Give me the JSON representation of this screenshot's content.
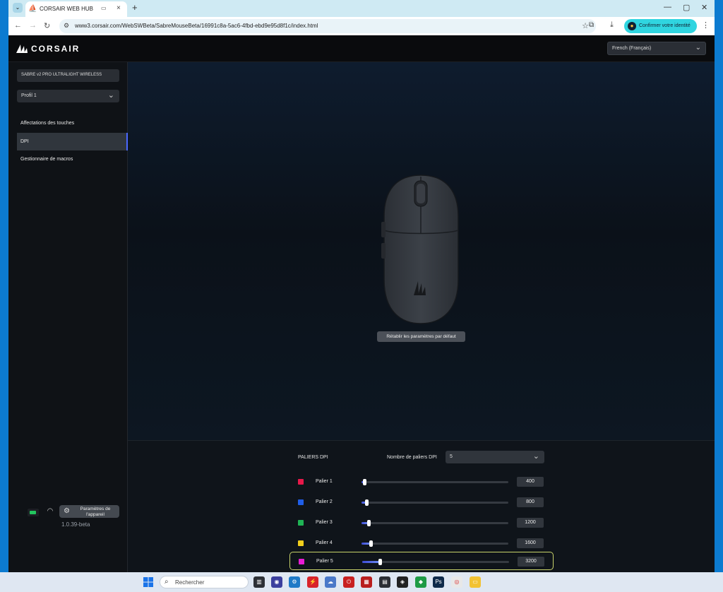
{
  "browser": {
    "tab_title": "CORSAIR WEB HUB",
    "url": "www3.corsair.com/WebSWBeta/SabreMouseBeta/16991c8a-5ac6-4fbd-ebd9e95d8f1c/index.html",
    "confirm_identity": "Confirmer votre identité"
  },
  "app": {
    "logo_text": "CORSAIR",
    "language": "French (Français)",
    "device_name": "SABRE v2 PRO ULTRALIGHT WIRELESS",
    "profile": "Profil 1",
    "nav": [
      {
        "label": "Affectations des touches"
      },
      {
        "label": "DPI"
      },
      {
        "label": "Gestionnaire de macros"
      }
    ],
    "device_settings": "Paramètres de l'appareil",
    "version": "1.0.39-beta",
    "reset_button": "Rétablir les paramètres par défaut"
  },
  "dpi": {
    "title": "PALIERS DPI",
    "count_label": "Nombre de paliers DPI",
    "count_value": "5",
    "stages": [
      {
        "label": "Palier 1",
        "value": "400",
        "color": "#e8194a",
        "fraction": 0.0
      },
      {
        "label": "Palier 2",
        "value": "800",
        "color": "#1f5ee8",
        "fraction": 0.015
      },
      {
        "label": "Palier 3",
        "value": "1200",
        "color": "#1fb455",
        "fraction": 0.03
      },
      {
        "label": "Palier 4",
        "value": "1600",
        "color": "#f2cf1c",
        "fraction": 0.045
      },
      {
        "label": "Palier 5",
        "value": "3200",
        "color": "#e81cd4",
        "fraction": 0.1
      }
    ],
    "selected_stage": 4
  },
  "taskbar": {
    "search_placeholder": "Rechercher"
  }
}
